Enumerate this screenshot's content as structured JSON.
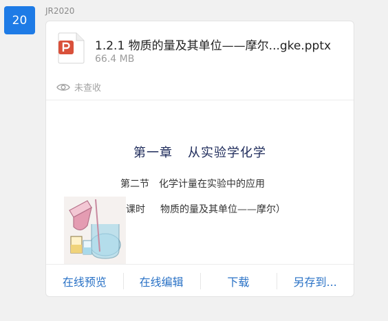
{
  "avatar": {
    "label": "20",
    "color": "#1e7be6"
  },
  "sender": {
    "name": "JR2020"
  },
  "file": {
    "name": "1.2.1 物质的量及其单位——摩尔...gke.pptx",
    "size": "66.4 MB",
    "icon": "ppt-file-icon",
    "icon_color": "#d9513b"
  },
  "status": {
    "icon": "eye-icon",
    "label": "未查收"
  },
  "slide": {
    "chapter": "第一章",
    "chapter_title": "从实验学化学",
    "section": "第二节",
    "section_title": "化学计量在实验中的应用",
    "lesson": "课时",
    "lesson_title": "物质的量及其单位——摩尔）"
  },
  "actions": {
    "preview": "在线预览",
    "edit": "在线编辑",
    "download": "下载",
    "save_as": "另存到..."
  },
  "colors": {
    "accent": "#2a72c6",
    "background": "#f1f1f1"
  }
}
